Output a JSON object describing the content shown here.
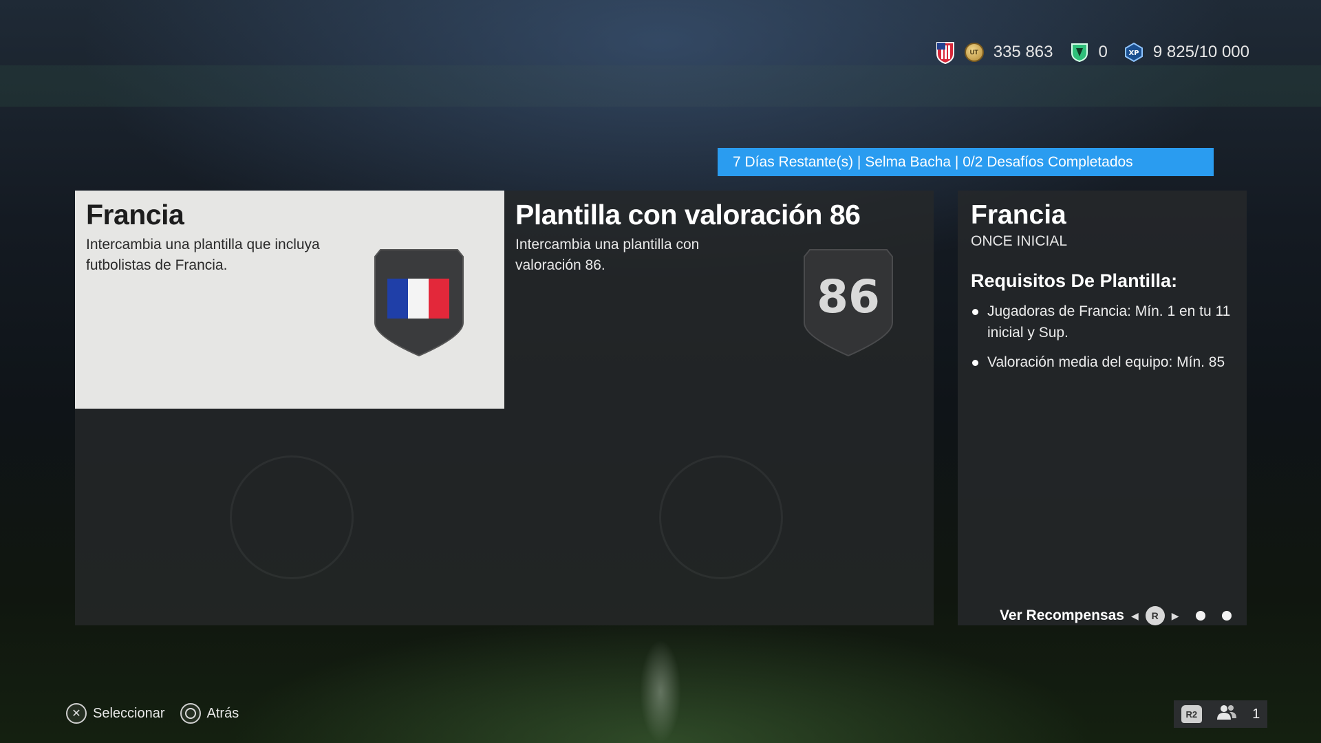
{
  "hud": {
    "coins": "335 863",
    "points": "0",
    "xp": "9 825/10 000"
  },
  "banner": {
    "text": "7 Días Restante(s) | Selma Bacha | 0/2 Desafíos Completados"
  },
  "challenges": [
    {
      "title": "Francia",
      "description": "Intercambia una plantilla que incluya futbolistas de Francia.",
      "badge": "france-flag"
    },
    {
      "title": "Plantilla con valoración 86",
      "description": "Intercambia una plantilla con valoración 86.",
      "badge_number": "86"
    }
  ],
  "side": {
    "title": "Francia",
    "subtitle": "ONCE INICIAL",
    "requirements_heading": "Requisitos De Plantilla:",
    "requirements": [
      "Jugadoras de Francia: Mín. 1 en tu 11 inicial y Sup.",
      "Valoración media del equipo: Mín. 85"
    ],
    "rewards_label": "Ver Recompensas",
    "rewards_button": "R"
  },
  "controls": {
    "select_label": "Seleccionar",
    "back_label": "Atrás"
  },
  "friends": {
    "button": "R2",
    "count": "1"
  },
  "colors": {
    "banner": "#2a9cf0",
    "selected_card": "#e6e6e4",
    "panel": "#26282a"
  }
}
